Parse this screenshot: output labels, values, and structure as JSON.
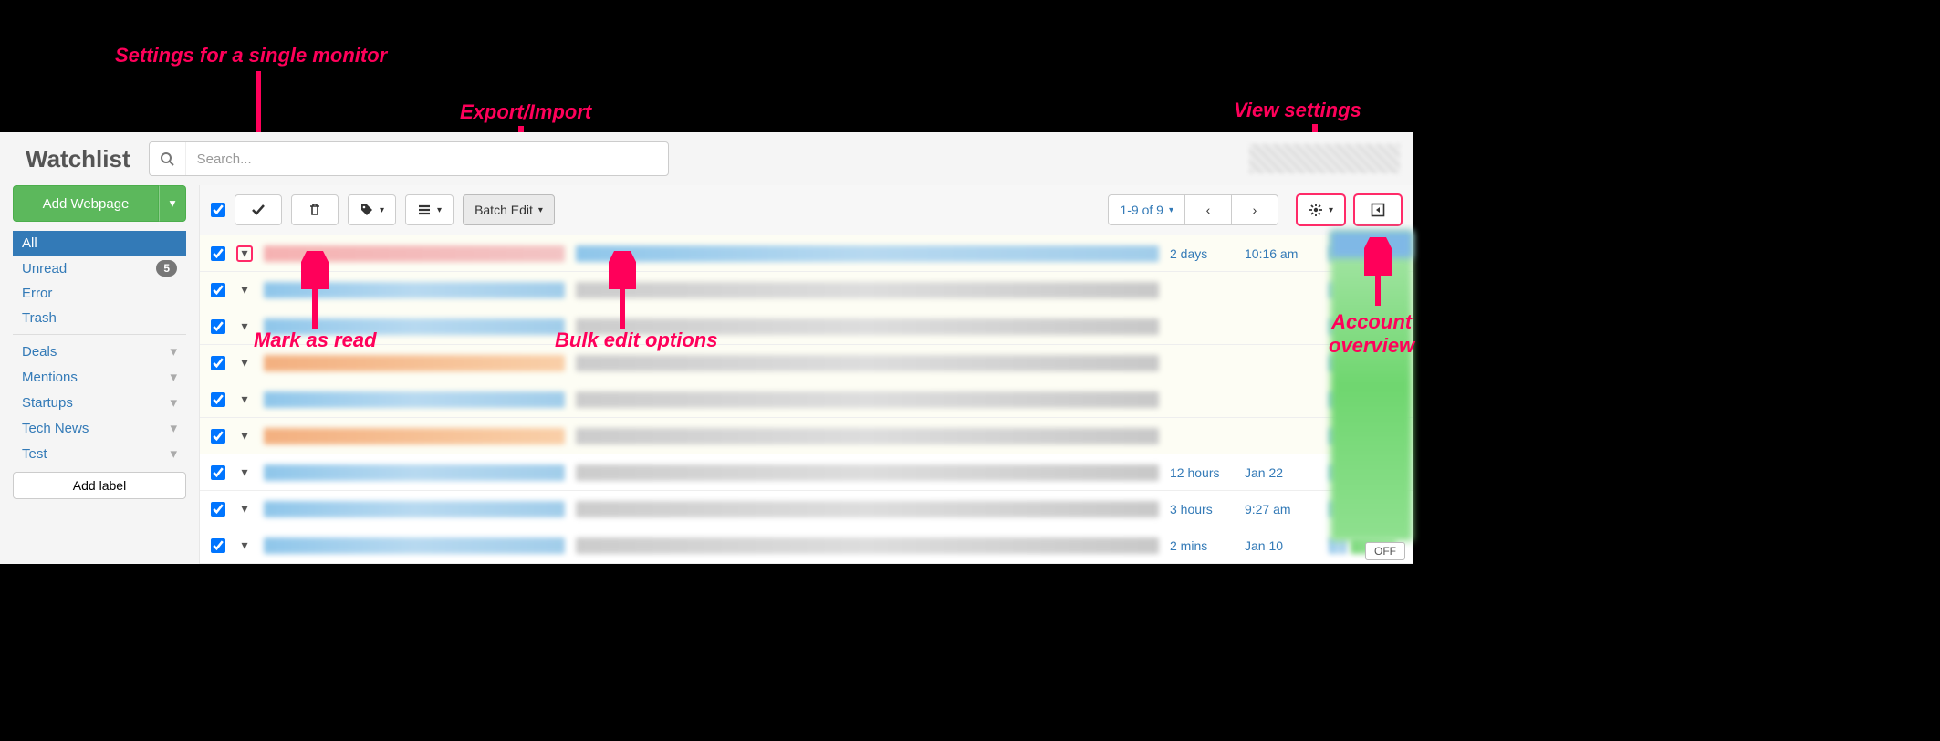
{
  "annotations": {
    "single_monitor": "Settings for a single monitor",
    "export_import": "Export/Import",
    "view_settings": "View settings",
    "mark_read": "Mark as read",
    "bulk_edit": "Bulk edit options",
    "account_overview": "Account\noverview"
  },
  "header": {
    "title": "Watchlist",
    "search_placeholder": "Search..."
  },
  "sidebar": {
    "add_button": "Add Webpage",
    "nav": [
      {
        "label": "All",
        "active": true
      },
      {
        "label": "Unread",
        "badge": "5"
      },
      {
        "label": "Error"
      },
      {
        "label": "Trash"
      }
    ],
    "labels": [
      {
        "label": "Deals"
      },
      {
        "label": "Mentions"
      },
      {
        "label": "Startups"
      },
      {
        "label": "Tech News"
      },
      {
        "label": "Test"
      }
    ],
    "add_label": "Add label"
  },
  "toolbar": {
    "batch_edit": "Batch Edit",
    "paging": "1-9 of 9"
  },
  "rows": [
    {
      "t1": "2 days",
      "t2": "10:16 am",
      "bg": "h",
      "title_cls": "blur-pink",
      "desc_cls": "blur-blue"
    },
    {
      "t1": "",
      "t2": "",
      "bg": "h",
      "title_cls": "blur-blue",
      "desc_cls": "blur-grey"
    },
    {
      "t1": "",
      "t2": "",
      "bg": "h",
      "title_cls": "blur-blue",
      "desc_cls": "blur-grey"
    },
    {
      "t1": "",
      "t2": "",
      "bg": "h",
      "title_cls": "blur-orange",
      "desc_cls": "blur-grey"
    },
    {
      "t1": "",
      "t2": "",
      "bg": "h",
      "title_cls": "blur-blue",
      "desc_cls": "blur-grey"
    },
    {
      "t1": "",
      "t2": "",
      "bg": "h",
      "title_cls": "blur-orange",
      "desc_cls": "blur-grey"
    },
    {
      "t1": "12 hours",
      "t2": "Jan 22",
      "bg": "w",
      "title_cls": "blur-blue",
      "desc_cls": "blur-grey"
    },
    {
      "t1": "3 hours",
      "t2": "9:27 am",
      "bg": "w",
      "title_cls": "blur-blue",
      "desc_cls": "blur-grey"
    },
    {
      "t1": "2 mins",
      "t2": "Jan 10",
      "bg": "w",
      "title_cls": "blur-blue",
      "desc_cls": "blur-grey"
    }
  ],
  "off_label": "OFF"
}
